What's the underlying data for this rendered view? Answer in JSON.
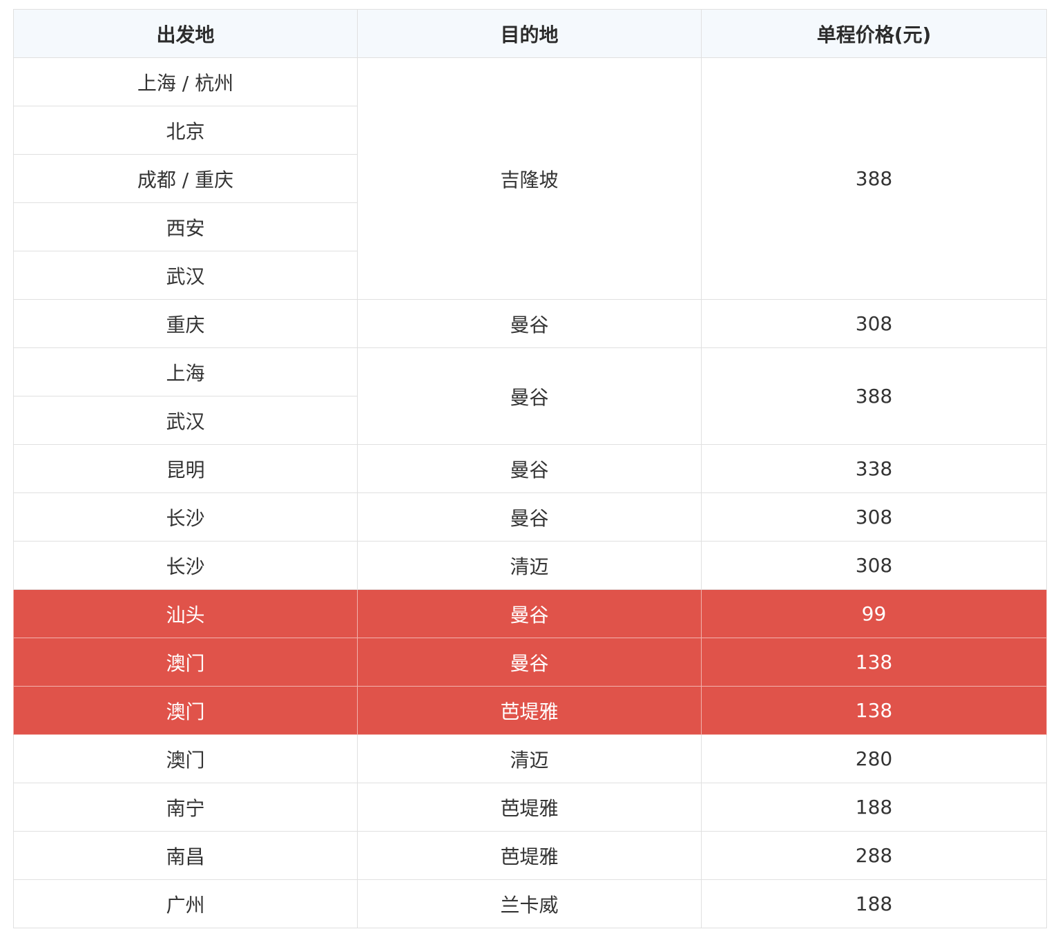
{
  "table": {
    "headers": [
      "出发地",
      "目的地",
      "单程价格(元)"
    ],
    "highlight_color": "#e0534a",
    "header_bg": "#f5f9fd",
    "group1": {
      "origins": [
        "上海 / 杭州",
        "北京",
        "成都 / 重庆",
        "西安",
        "武汉"
      ],
      "destination": "吉隆坡",
      "price": "388"
    },
    "row_cq": {
      "origin": "重庆",
      "destination": "曼谷",
      "price": "308"
    },
    "group2": {
      "origins": [
        "上海",
        "武汉"
      ],
      "destination": "曼谷",
      "price": "388"
    },
    "rows": [
      {
        "origin": "昆明",
        "destination": "曼谷",
        "price": "338"
      },
      {
        "origin": "长沙",
        "destination": "曼谷",
        "price": "308"
      },
      {
        "origin": "长沙",
        "destination": "清迈",
        "price": "308"
      },
      {
        "origin": "汕头",
        "destination": "曼谷",
        "price": "99"
      },
      {
        "origin": "澳门",
        "destination": "曼谷",
        "price": "138"
      },
      {
        "origin": "澳门",
        "destination": "芭堤雅",
        "price": "138"
      },
      {
        "origin": "澳门",
        "destination": "清迈",
        "price": "280"
      },
      {
        "origin": "南宁",
        "destination": "芭堤雅",
        "price": "188"
      },
      {
        "origin": "南昌",
        "destination": "芭堤雅",
        "price": "288"
      },
      {
        "origin": "广州",
        "destination": "兰卡威",
        "price": "188"
      }
    ]
  }
}
